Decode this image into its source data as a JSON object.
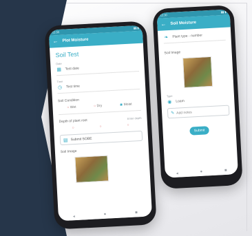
{
  "front_phone": {
    "status_left": "12:30",
    "status_right": "▮▮ ▮",
    "appbar_title": "Plot Moisture",
    "section_title": "Soil Test",
    "field_date_label": "Date",
    "field_date_value": "Test date",
    "field_time_label": "Time",
    "field_time_value": "Test time",
    "soil_question": "Soil Condition",
    "choices": [
      "Wet",
      "Dry",
      "Moist"
    ],
    "depth_question": "Depth of plant root",
    "depth_hint": "Enter depth",
    "depth_value": "Submit SOBE",
    "image_title": "Soil Image"
  },
  "back_phone": {
    "appbar_title": "Soil Moisture",
    "top_label": "Plant type - number",
    "image_title": "Soil Image",
    "field_label": "Type",
    "field_value": "Loam",
    "input_placeholder": "Add notes",
    "submit_label": "Submit"
  },
  "colors": {
    "accent": "#3aaec6",
    "navy_background": "#26364a"
  }
}
